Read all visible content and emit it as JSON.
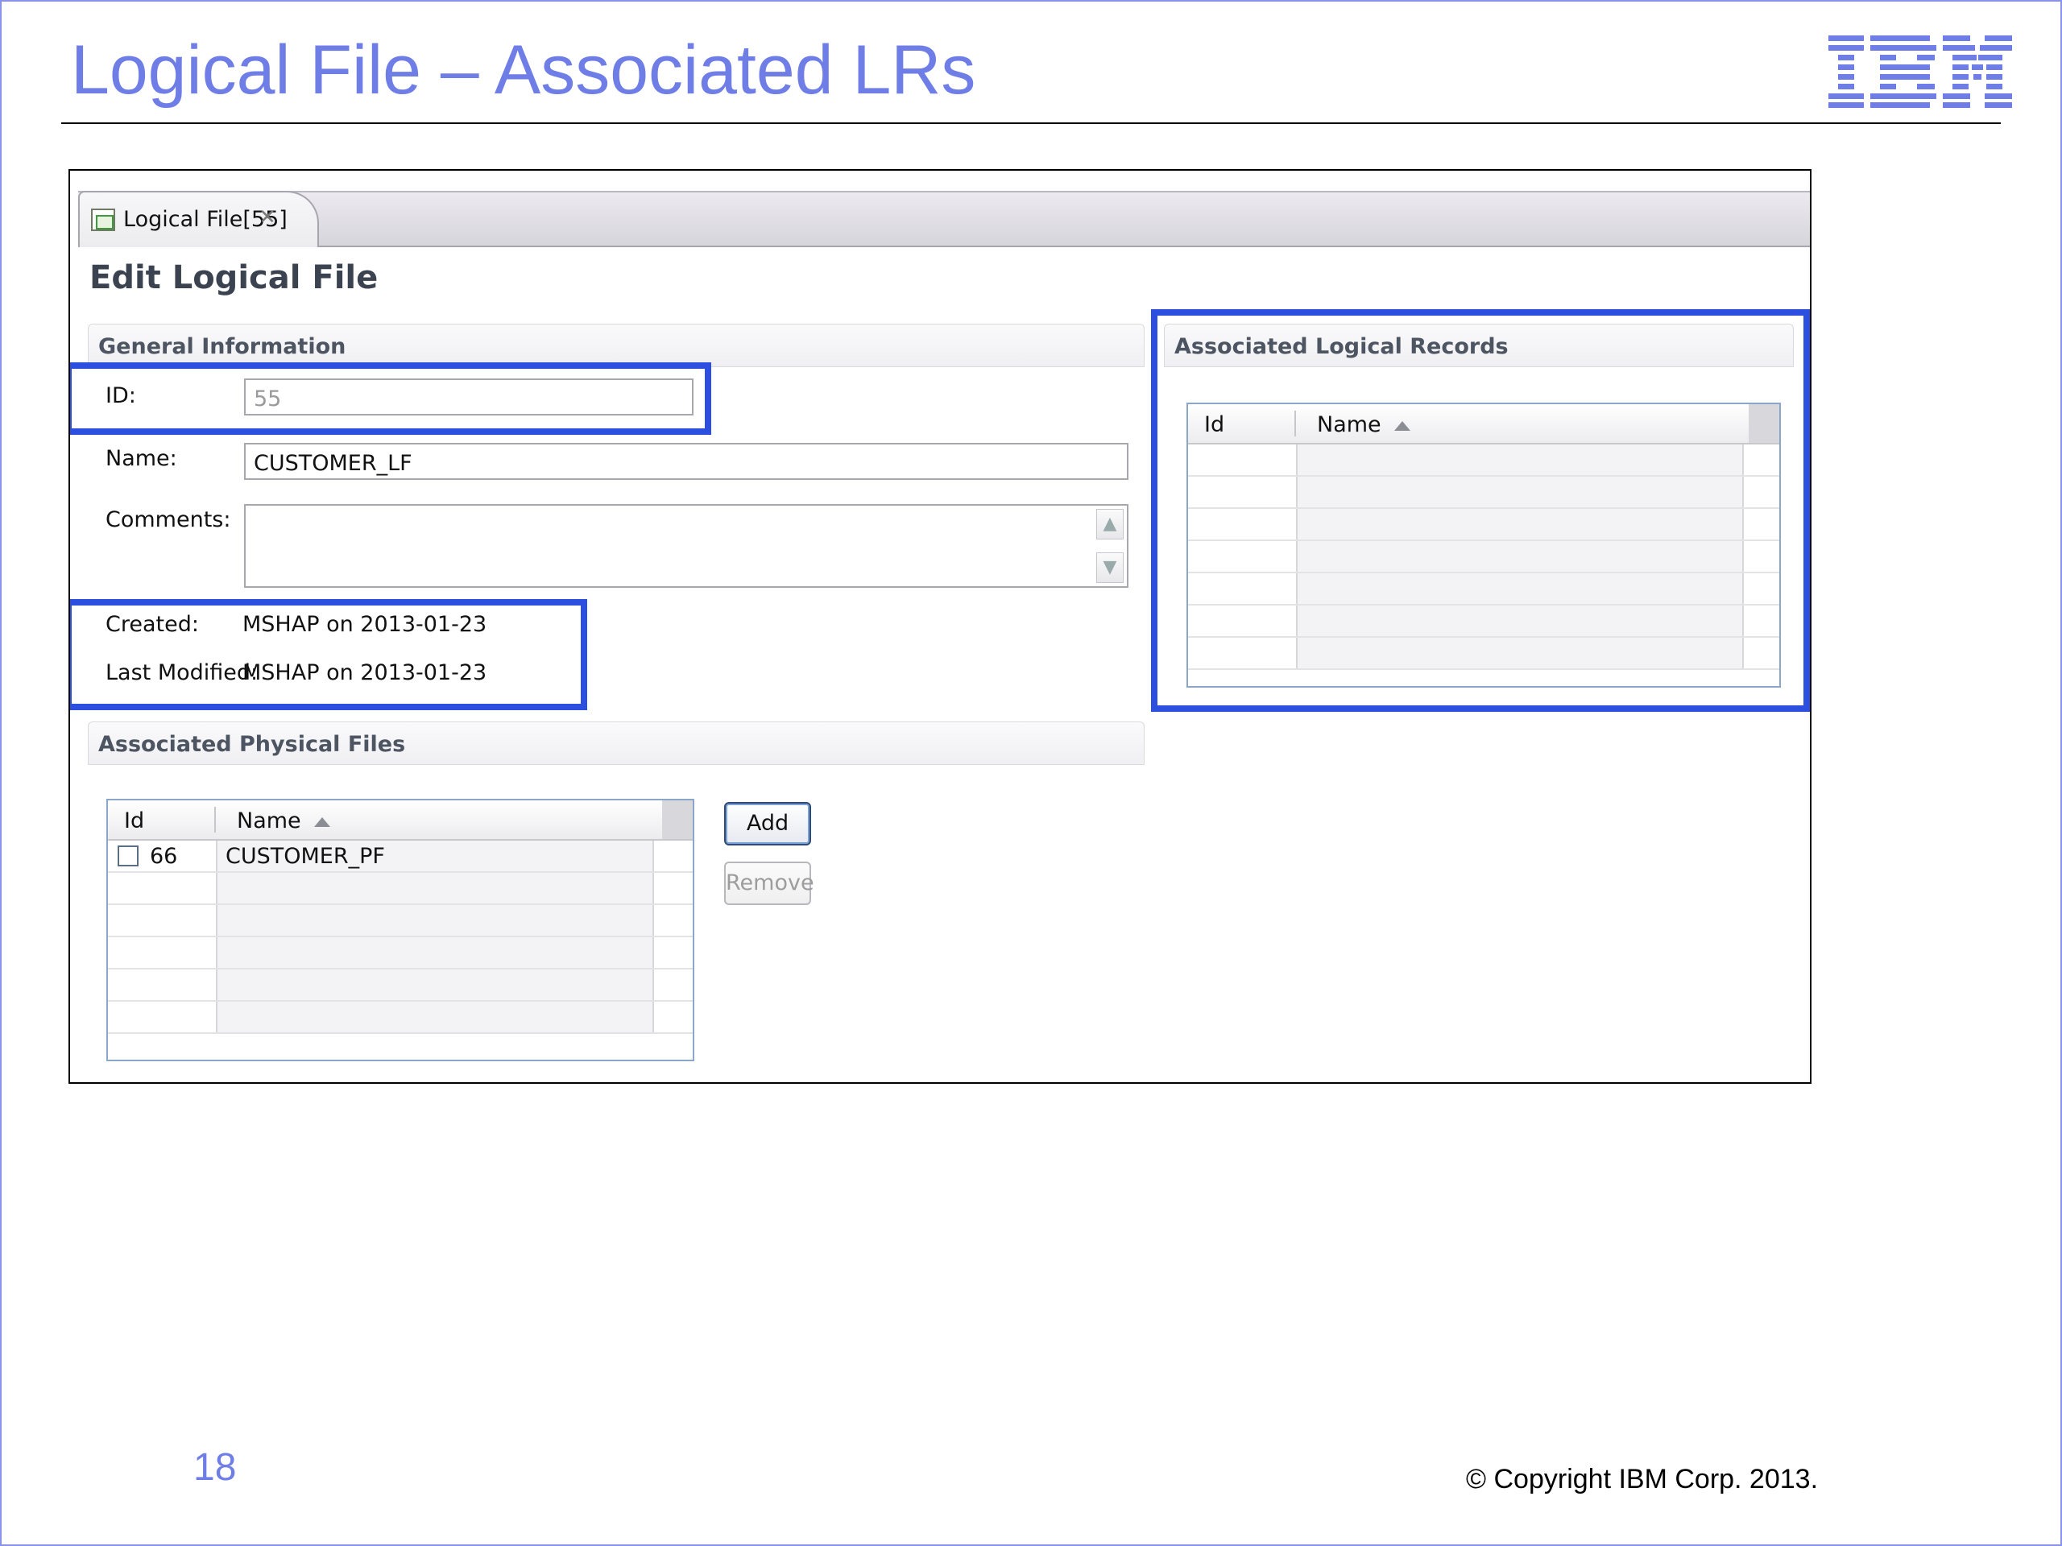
{
  "slide": {
    "title": "Logical File – Associated LRs",
    "page_number": "18",
    "copyright": "© Copyright IBM Corp. 2013.",
    "logo_alt": "IBM",
    "title_color": "#6f7ee6",
    "highlight_color": "#2d4fe0"
  },
  "editor": {
    "tab_label": "Logical File[55]",
    "tab_icon": "logical-file-icon",
    "close_icon": "close-icon",
    "form_title": "Edit Logical File",
    "general": {
      "header": "General Information",
      "id_label": "ID:",
      "id_value": "55",
      "name_label": "Name:",
      "name_value": "CUSTOMER_LF",
      "comments_label": "Comments:",
      "comments_value": "",
      "created_label": "Created:",
      "created_value": "MSHAP on 2013-01-23",
      "modified_label": "Last Modified:",
      "modified_value": "MSHAP on 2013-01-23"
    },
    "logical_records": {
      "header": "Associated Logical Records",
      "columns": [
        "Id",
        "Name"
      ],
      "rows": []
    },
    "physical_files": {
      "header": "Associated Physical Files",
      "columns": [
        "Id",
        "Name"
      ],
      "rows": [
        {
          "id": "66",
          "name": "CUSTOMER_PF",
          "checked": false
        }
      ],
      "add_label": "Add",
      "remove_label": "Remove"
    }
  }
}
